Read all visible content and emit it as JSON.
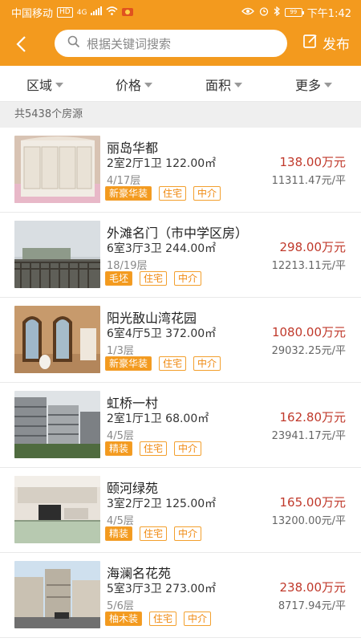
{
  "status_bar": {
    "carrier": "中国移动",
    "hd": "HD",
    "net": "4G",
    "battery": "99",
    "time": "下午1:42"
  },
  "header": {
    "search_placeholder": "根据关键词搜索",
    "publish_label": "发布"
  },
  "filters": [
    "区域",
    "价格",
    "面积",
    "更多"
  ],
  "listing_count": "共5438个房源",
  "listings": [
    {
      "title": "丽岛华都",
      "spec": "2室2厅1卫 122.00㎡",
      "floor": "4/17层",
      "tags": [
        "新豪华装",
        "住宅",
        "中介"
      ],
      "price": "138.00万元",
      "unit_price": "11311.47元/平"
    },
    {
      "title": "外滩名门（市中学区房）",
      "spec": "6室3厅3卫 244.00㎡",
      "floor": "18/19层",
      "tags": [
        "毛坯",
        "住宅",
        "中介"
      ],
      "price": "298.00万元",
      "unit_price": "12213.11元/平"
    },
    {
      "title": "阳光敔山湾花园",
      "spec": "6室4厅5卫 372.00㎡",
      "floor": "1/3层",
      "tags": [
        "新豪华装",
        "住宅",
        "中介"
      ],
      "price": "1080.00万元",
      "unit_price": "29032.25元/平"
    },
    {
      "title": "虹桥一村",
      "spec": "2室1厅1卫 68.00㎡",
      "floor": "4/5层",
      "tags": [
        "精装",
        "住宅",
        "中介"
      ],
      "price": "162.80万元",
      "unit_price": "23941.17元/平"
    },
    {
      "title": "颐河绿苑",
      "spec": "3室2厅2卫 125.00㎡",
      "floor": "4/5层",
      "tags": [
        "精装",
        "住宅",
        "中介"
      ],
      "price": "165.00万元",
      "unit_price": "13200.00元/平"
    },
    {
      "title": "海澜名花苑",
      "spec": "5室3厅3卫 273.00㎡",
      "floor": "5/6层",
      "tags": [
        "柚木装",
        "住宅",
        "中介"
      ],
      "price": "238.00万元",
      "unit_price": "8717.94元/平"
    }
  ],
  "colors": {
    "brand": "#f39a1e",
    "price": "#c0392b",
    "tag_text": "#f08a12"
  }
}
